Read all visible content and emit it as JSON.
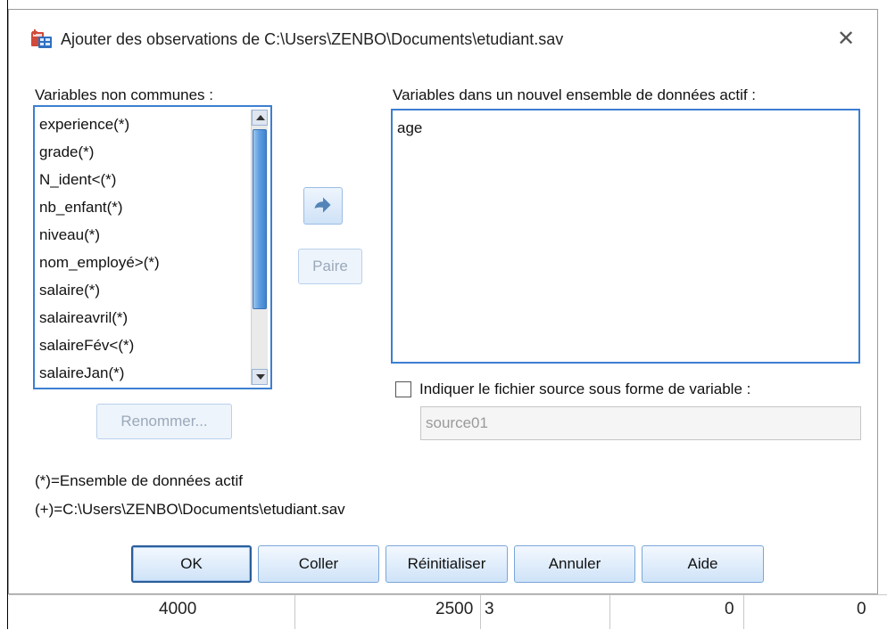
{
  "dialog": {
    "title": "Ajouter des observations de C:\\Users\\ZENBO\\Documents\\etudiant.sav",
    "close_symbol": "✕",
    "icon": "spss-add-cases-icon"
  },
  "left_panel": {
    "label": "Variables non communes :",
    "items": [
      "experience(*)",
      "grade(*)",
      "N_ident<(*)",
      "nb_enfant(*)",
      "niveau(*)",
      "nom_employé>(*)",
      "salaire(*)",
      "salaireavril(*)",
      "salaireFév<(*)",
      "salaireJan(*)"
    ],
    "rename_button": "Renommer..."
  },
  "middle": {
    "move_icon": "arrow-right-icon",
    "pair_button": "Paire"
  },
  "right_panel": {
    "label": "Variables dans un nouvel ensemble de données actif :",
    "items": [
      "age"
    ],
    "indicate_source_label": "Indiquer le fichier source sous forme de variable :",
    "indicate_source_checked": false,
    "source_field_value": "source01"
  },
  "legend": {
    "active": "(*)=Ensemble de données actif",
    "file": "(+)=C:\\Users\\ZENBO\\Documents\\etudiant.sav"
  },
  "buttons": {
    "ok": "OK",
    "paste": "Coller",
    "reset": "Réinitialiser",
    "cancel": "Annuler",
    "help": "Aide"
  },
  "background": {
    "cell_values": [
      "4000",
      "2500",
      "3",
      "0",
      "0"
    ]
  },
  "colors": {
    "listbox_border": "#3c7fd1",
    "button_gradient_top": "#f3f8fe",
    "button_gradient_bottom": "#cfe3f8"
  }
}
